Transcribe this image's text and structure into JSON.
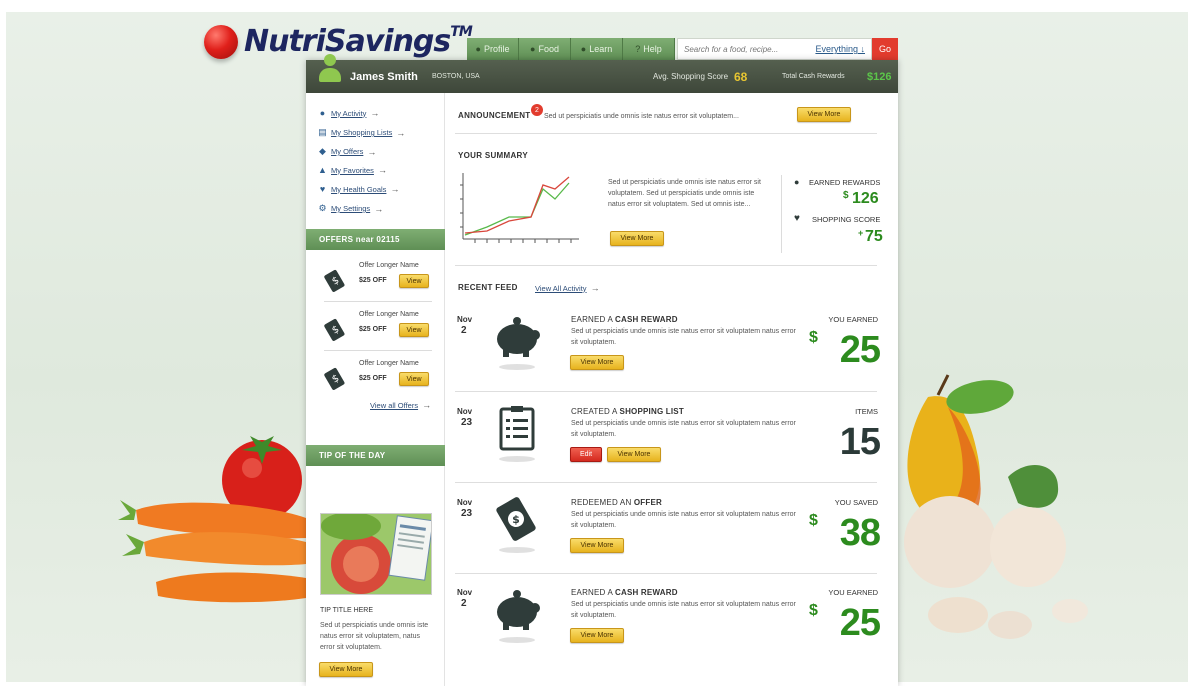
{
  "brand": {
    "name": "NutriSavings",
    "tm": "TM"
  },
  "nav": {
    "tabs": [
      {
        "label": "Profile",
        "icon": "person-icon"
      },
      {
        "label": "Food",
        "icon": "apple-icon"
      },
      {
        "label": "Learn",
        "icon": "bulb-icon"
      },
      {
        "label": "Help",
        "icon": "question-icon"
      }
    ],
    "search_placeholder": "Search for a food, recipe...",
    "search_scope": "Everything",
    "go_label": "Go"
  },
  "header": {
    "user_name": "James Smith",
    "location": "BOSTON, USA",
    "avg_score_label": "Avg. Shopping Score",
    "avg_score_value": "68",
    "total_rewards_label": "Total Cash Rewards",
    "total_rewards_value": "$126"
  },
  "sidebar": {
    "menu": [
      {
        "label": "My Activity",
        "icon": "person-icon"
      },
      {
        "label": "My Shopping Lists",
        "icon": "clipboard-icon"
      },
      {
        "label": "My Offers",
        "icon": "tag-icon"
      },
      {
        "label": "My Favorites",
        "icon": "thumbs-up-icon"
      },
      {
        "label": "My Health Goals",
        "icon": "heart-icon"
      },
      {
        "label": "My Settings",
        "icon": "gear-icon"
      }
    ],
    "offers_title": "OFFERS near 02115",
    "offers": [
      {
        "name": "Offer Longer Name",
        "amount": "$25 OFF",
        "button": "View"
      },
      {
        "name": "Offer Longer Name",
        "amount": "$25 OFF",
        "button": "View"
      },
      {
        "name": "Offer Longer Name",
        "amount": "$25 OFF",
        "button": "View"
      }
    ],
    "view_all_offers": "View all Offers",
    "tip_title_bar": "TIP OF THE DAY",
    "tip_heading": "TIP TITLE HERE",
    "tip_text": "Sed ut perspiciatis unde omnis iste natus error sit voluptatem, natus error sit voluptatem.",
    "tip_button": "View More"
  },
  "announcement": {
    "label": "ANNOUNCEMENT",
    "badge": "2",
    "text": "Sed ut perspiciatis unde omnis iste natus error sit voluptatem...",
    "button": "View More"
  },
  "summary": {
    "title": "YOUR SUMMARY",
    "text": "Sed ut perspiciatis unde omnis iste natus error sit voluptatem.  Sed ut perspiciatis unde omnis iste natus error sit voluptatem. Sed ut omnis iste...",
    "button": "View More",
    "earned_label": "EARNED REWARDS",
    "earned_dollar": "$",
    "earned_value": "126",
    "score_label": "SHOPPING SCORE",
    "score_plus": "+",
    "score_value": "75",
    "colors": {
      "red_line": "#d9473c",
      "green_line": "#58b94a"
    }
  },
  "feed": {
    "title": "RECENT FEED",
    "view_all": "View All Activity",
    "items": [
      {
        "month": "Nov",
        "day": "2",
        "title_pre": "EARNED A ",
        "title_bold": "CASH REWARD",
        "desc": "Sed ut perspiciatis unde omnis iste natus error sit voluptatem natus error sit voluptatem.",
        "meta": "YOU EARNED",
        "dollar": "$",
        "value": "25",
        "value_color": "#2c8b1e",
        "icon": "piggy-bank-icon",
        "buttons": [
          "View More"
        ]
      },
      {
        "month": "Nov",
        "day": "23",
        "title_pre": "CREATED A ",
        "title_bold": "SHOPPING LIST",
        "desc": "Sed ut perspiciatis unde omnis iste natus error sit voluptatem natus error sit voluptatem.",
        "meta": "ITEMS",
        "dollar": "",
        "value": "15",
        "value_color": "#2b3a38",
        "icon": "clipboard-icon",
        "buttons": [
          "Edit",
          "View More"
        ]
      },
      {
        "month": "Nov",
        "day": "23",
        "title_pre": "REDEEMED AN ",
        "title_bold": "OFFER",
        "desc": "Sed ut perspiciatis unde omnis iste natus error sit voluptatem natus error sit voluptatem.",
        "meta": "YOU SAVED",
        "dollar": "$",
        "value": "38",
        "value_color": "#2c8b1e",
        "icon": "dollar-tag-icon",
        "buttons": [
          "View More"
        ]
      },
      {
        "month": "Nov",
        "day": "2",
        "title_pre": "EARNED A ",
        "title_bold": "CASH REWARD",
        "desc": "Sed ut perspiciatis unde omnis iste natus error sit voluptatem natus error sit voluptatem.",
        "meta": "YOU EARNED",
        "dollar": "$",
        "value": "25",
        "value_color": "#2c8b1e",
        "icon": "piggy-bank-icon",
        "buttons": [
          "View More"
        ]
      }
    ]
  }
}
